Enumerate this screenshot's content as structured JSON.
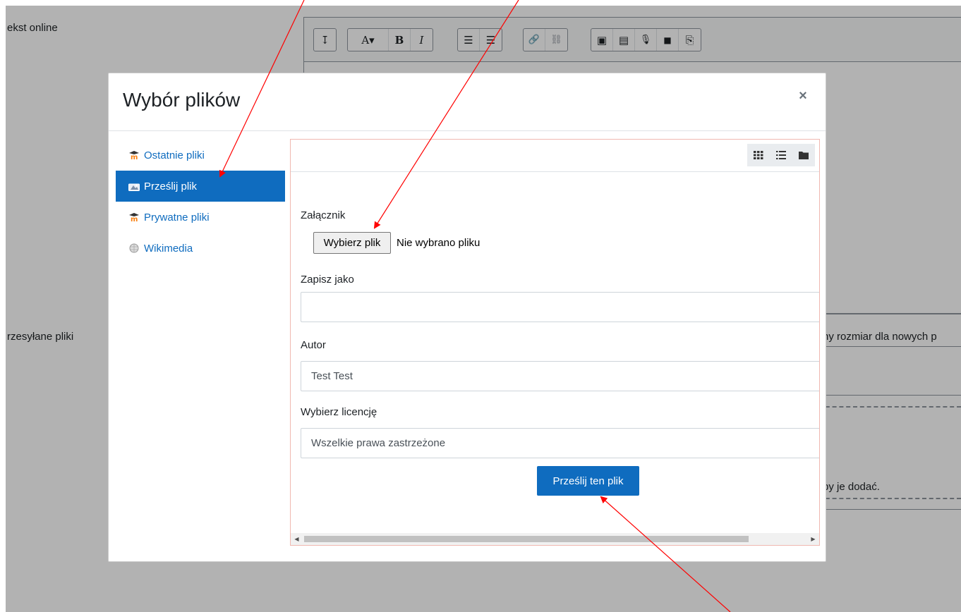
{
  "page": {
    "online_text_label": "ekst online",
    "uploaded_files_label": "rzesyłane pliki",
    "max_size_fragment": "ny rozmiar dla nowych p",
    "drag_hint_fragment": "by je dodać."
  },
  "editor_toolbar": {
    "buttons": [
      {
        "name": "collapse",
        "glyph": "↧"
      },
      {
        "name": "font-style",
        "glyph": "A▾"
      },
      {
        "name": "bold",
        "glyph": "B"
      },
      {
        "name": "italic",
        "glyph": "I"
      },
      {
        "name": "unordered-list",
        "glyph": "☰"
      },
      {
        "name": "ordered-list",
        "glyph": "☰"
      },
      {
        "name": "link",
        "glyph": "🔗"
      },
      {
        "name": "unlink",
        "glyph": "⛓"
      },
      {
        "name": "image",
        "glyph": "▣"
      },
      {
        "name": "media",
        "glyph": "▤"
      },
      {
        "name": "record-audio",
        "glyph": "🎙"
      },
      {
        "name": "record-video",
        "glyph": "■"
      },
      {
        "name": "manage-files",
        "glyph": "⎘"
      }
    ]
  },
  "modal": {
    "title": "Wybór plików",
    "close_symbol": "×"
  },
  "nav": {
    "items": [
      {
        "label": "Ostatnie pliki",
        "icon": "moodle-icon",
        "active": false
      },
      {
        "label": "Prześlij plik",
        "icon": "upload-icon",
        "active": true
      },
      {
        "label": "Prywatne pliki",
        "icon": "moodle-icon",
        "active": false
      },
      {
        "label": "Wikimedia",
        "icon": "wikimedia-icon",
        "active": false
      }
    ]
  },
  "upload_form": {
    "attachment_label": "Załącznik",
    "choose_file_button": "Wybierz plik",
    "file_status": "Nie wybrano pliku",
    "save_as_label": "Zapisz jako",
    "save_as_value": "",
    "author_label": "Autor",
    "author_value": "Test Test",
    "license_label": "Wybierz licencję",
    "license_value": "Wszelkie prawa zastrzeżone",
    "submit_button": "Prześlij ten plik"
  },
  "colors": {
    "accent": "#0f6cbf",
    "annotation_arrow": "#ff0000",
    "overlay": "rgba(0,0,0,0.30)"
  }
}
